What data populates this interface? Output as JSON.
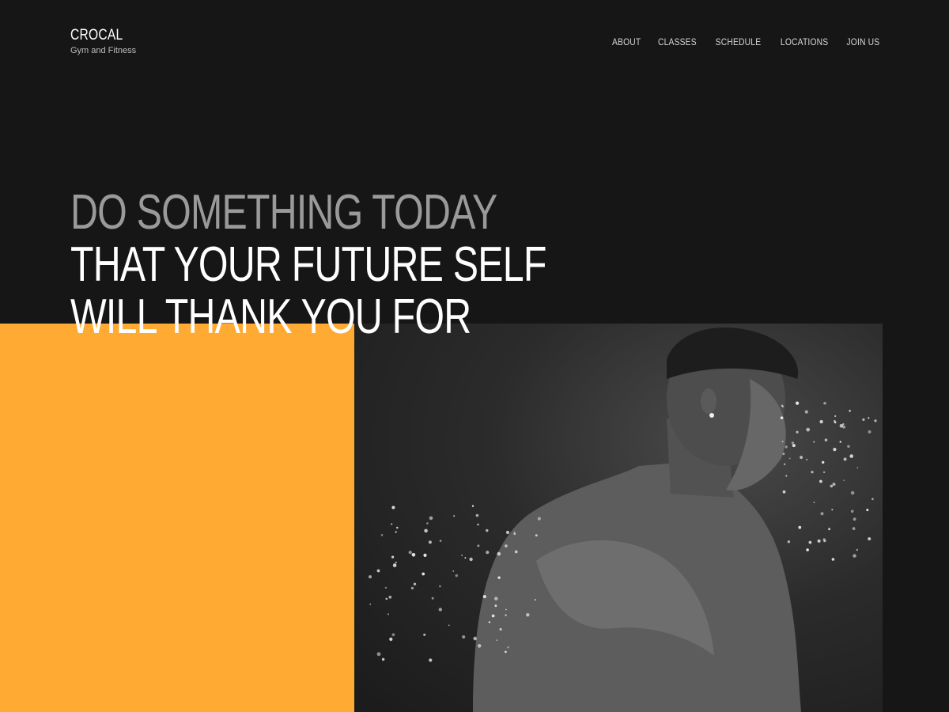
{
  "brand": {
    "name": "CROCAL",
    "tagline": "Gym and Fitness"
  },
  "nav": {
    "items": [
      {
        "label": "ABOUT"
      },
      {
        "label": "CLASSES"
      },
      {
        "label": "SCHEDULE"
      },
      {
        "label": "LOCATIONS"
      },
      {
        "label": "JOIN US"
      }
    ]
  },
  "hero": {
    "line1": "DO SOMETHING TODAY",
    "line2": "THAT YOUR FUTURE SELF",
    "line3": "WILL THANK YOU FOR"
  },
  "colors": {
    "background": "#161616",
    "accent": "#FFAA33",
    "headline_muted": "#9a9a9a",
    "headline_bright": "#ffffff"
  },
  "images": {
    "hero_photo": "black-and-white photo of athlete with water spray"
  }
}
